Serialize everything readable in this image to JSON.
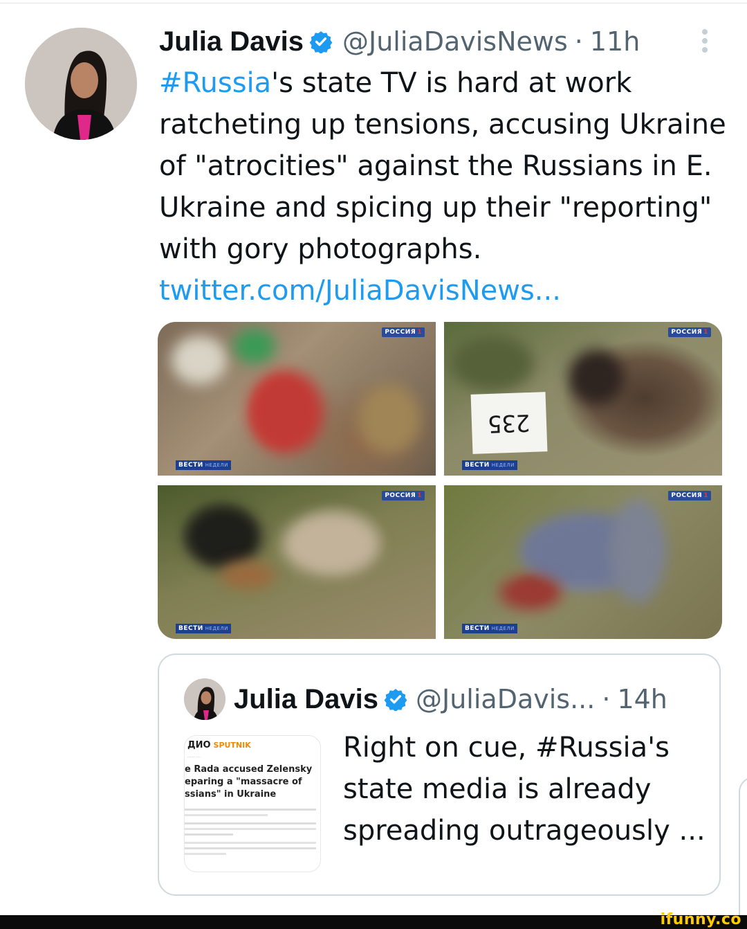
{
  "tweet": {
    "author_name": "Julia Davis",
    "handle": "@JuliaDavisNews",
    "separator": "·",
    "time": "11h",
    "text_lines": [
      {
        "hashtag": "#Russia",
        "rest": "'s state TV is hard at work"
      },
      "ratcheting up tensions, accusing Ukraine",
      "of \"atrocities\" against the Russians in E.",
      "Ukraine and spicing up their \"reporting\"",
      "with gory photographs."
    ],
    "link": "twitter.com/JuliaDavisNews...",
    "verified_icon": "verified-badge-icon",
    "more_icon": "more-vertical-icon",
    "media": [
      {
        "channel_logo": "РОССИЯ",
        "channel_num": "1",
        "show_logo": "ВЕСТИ",
        "show_sub": "НЕДЕЛИ"
      },
      {
        "channel_logo": "РОССИЯ",
        "channel_num": "1",
        "show_logo": "ВЕСТИ",
        "show_sub": "НЕДЕЛИ",
        "tag_number": "235"
      },
      {
        "channel_logo": "РОССИЯ",
        "channel_num": "1",
        "show_logo": "ВЕСТИ",
        "show_sub": "НЕДЕЛИ"
      },
      {
        "channel_logo": "РОССИЯ",
        "channel_num": "1",
        "show_logo": "ВЕСТИ",
        "show_sub": "НЕДЕЛИ"
      }
    ]
  },
  "quoted": {
    "author_name": "Julia Davis",
    "handle": "@JuliaDavis...",
    "separator": "·",
    "time": "14h",
    "text_lines": [
      "Right on cue, #Russia's",
      "state media is already",
      "spreading outrageously ..."
    ],
    "thumb": {
      "brand": "ДИО",
      "brand_accent": "SPUTNIK",
      "headline_lines": [
        "e Rada accused Zelensky",
        "eparing a \"massacre of",
        "ssians\" in Ukraine"
      ]
    }
  },
  "watermark": "ifunny.co",
  "colors": {
    "link": "#1d9bf0",
    "secondary_text": "#536471",
    "border": "#cfd9de",
    "verified": "#1d9bf0",
    "watermark": "#ffcc00"
  }
}
